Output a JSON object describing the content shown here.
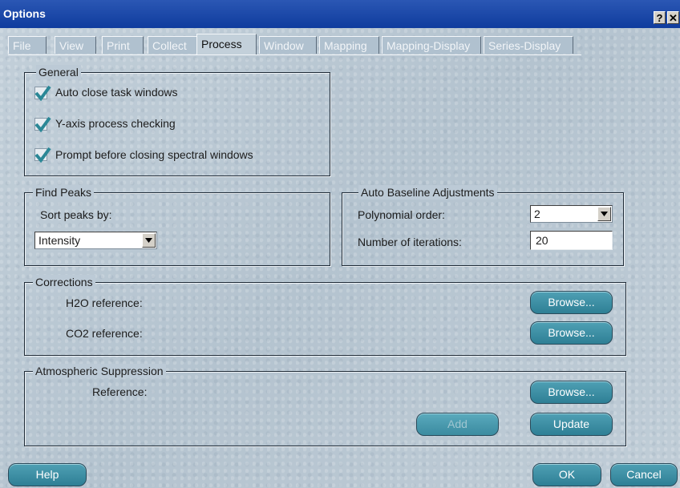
{
  "window": {
    "title": "Options",
    "help_label": "?",
    "close_label": "✕"
  },
  "tabs": [
    {
      "label": "File"
    },
    {
      "label": "View"
    },
    {
      "label": "Print"
    },
    {
      "label": "Collect"
    },
    {
      "label": "Process"
    },
    {
      "label": "Window"
    },
    {
      "label": "Mapping"
    },
    {
      "label": "Mapping-Display"
    },
    {
      "label": "Series-Display"
    }
  ],
  "active_tab": "Process",
  "general": {
    "title": "General",
    "options": [
      {
        "label": "Auto close task windows",
        "checked": true
      },
      {
        "label": "Y-axis process checking",
        "checked": true
      },
      {
        "label": "Prompt before closing spectral windows",
        "checked": true
      }
    ]
  },
  "find_peaks": {
    "title": "Find Peaks",
    "sort_label": "Sort peaks by:",
    "sort_value": "Intensity"
  },
  "baseline": {
    "title": "Auto Baseline Adjustments",
    "poly_label": "Polynomial order:",
    "poly_value": "2",
    "iter_label": "Number of iterations:",
    "iter_value": "20"
  },
  "corrections": {
    "title": "Corrections",
    "h2o_label": "H2O reference:",
    "co2_label": "CO2 reference:",
    "browse_label": "Browse..."
  },
  "atmospheric": {
    "title": "Atmospheric Suppression",
    "ref_label": "Reference:",
    "browse_label": "Browse...",
    "add_label": "Add",
    "update_label": "Update"
  },
  "footer": {
    "help_label": "Help",
    "ok_label": "OK",
    "cancel_label": "Cancel"
  },
  "colors": {
    "accent": "#2e7f95",
    "title_bar": "#1a45a8",
    "panel": "#bccad6"
  },
  "icons": {
    "check": "checkmark-icon",
    "dropdown": "chevron-down-icon"
  }
}
